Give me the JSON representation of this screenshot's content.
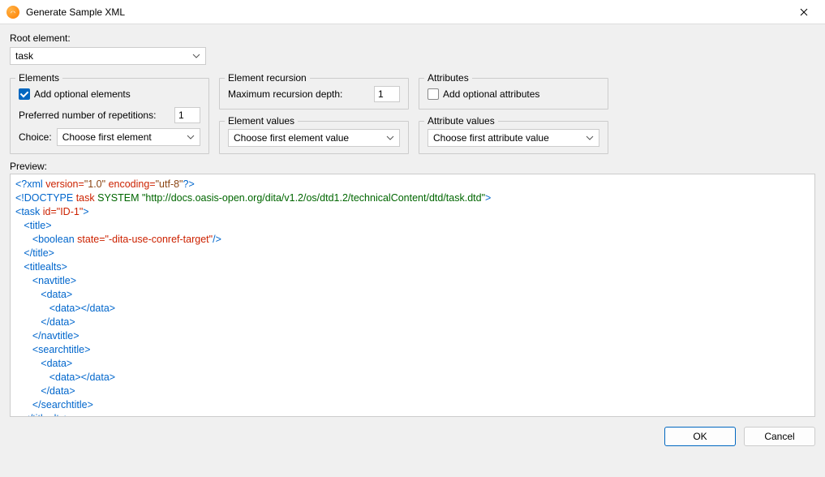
{
  "window": {
    "title": "Generate Sample XML"
  },
  "root": {
    "label": "Root element:",
    "value": "task"
  },
  "elements_group": {
    "legend": "Elements",
    "add_optional_label": "Add optional elements",
    "add_optional_checked": true,
    "preferred_label": "Preferred number of repetitions:",
    "preferred_value": "1",
    "choice_label": "Choice:",
    "choice_value": "Choose first element"
  },
  "recursion_group": {
    "legend": "Element recursion",
    "max_depth_label": "Maximum recursion depth:",
    "max_depth_value": "1"
  },
  "attributes_group": {
    "legend": "Attributes",
    "add_optional_label": "Add optional attributes",
    "add_optional_checked": false
  },
  "element_values_group": {
    "legend": "Element values",
    "value": "Choose first element value"
  },
  "attribute_values_group": {
    "legend": "Attribute values",
    "value": "Choose first attribute value"
  },
  "preview": {
    "label": "Preview:",
    "lines": [
      {
        "type": "pi",
        "raw": "<?xml version=\"1.0\" encoding=\"utf-8\"?>"
      },
      {
        "type": "doctype",
        "root": "task",
        "rest": "SYSTEM \"http://docs.oasis-open.org/dita/v1.2/os/dtd1.2/technicalContent/dtd/task.dtd\""
      },
      {
        "type": "open",
        "indent": 0,
        "name": "task",
        "attrs": [
          {
            "n": "id",
            "v": "ID-1"
          }
        ]
      },
      {
        "type": "open",
        "indent": 1,
        "name": "title"
      },
      {
        "type": "empty",
        "indent": 2,
        "name": "boolean",
        "attrs": [
          {
            "n": "state",
            "v": "-dita-use-conref-target"
          }
        ]
      },
      {
        "type": "close",
        "indent": 1,
        "name": "title"
      },
      {
        "type": "open",
        "indent": 1,
        "name": "titlealts"
      },
      {
        "type": "open",
        "indent": 2,
        "name": "navtitle"
      },
      {
        "type": "open",
        "indent": 3,
        "name": "data"
      },
      {
        "type": "openclose",
        "indent": 4,
        "name": "data"
      },
      {
        "type": "close",
        "indent": 3,
        "name": "data"
      },
      {
        "type": "close",
        "indent": 2,
        "name": "navtitle"
      },
      {
        "type": "open",
        "indent": 2,
        "name": "searchtitle"
      },
      {
        "type": "open",
        "indent": 3,
        "name": "data"
      },
      {
        "type": "openclose",
        "indent": 4,
        "name": "data"
      },
      {
        "type": "close",
        "indent": 3,
        "name": "data"
      },
      {
        "type": "close",
        "indent": 2,
        "name": "searchtitle"
      },
      {
        "type": "close",
        "indent": 1,
        "name": "titlealts"
      }
    ]
  },
  "buttons": {
    "ok": "OK",
    "cancel": "Cancel"
  }
}
